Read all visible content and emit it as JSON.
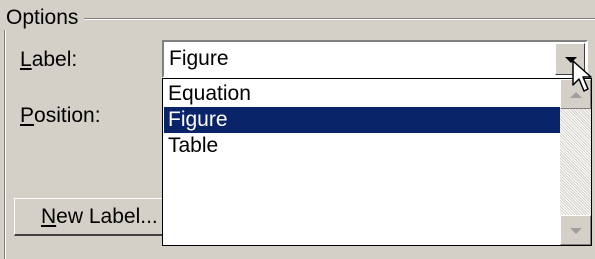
{
  "group": {
    "legend": "Options"
  },
  "label_field": {
    "label_prefix": "L",
    "label_rest": "abel:",
    "value": "Figure"
  },
  "position_field": {
    "label_prefix": "P",
    "label_rest": "osition:"
  },
  "dropdown": {
    "options": [
      "Equation",
      "Figure",
      "Table"
    ],
    "selected": "Figure"
  },
  "new_label_button": {
    "label_prefix": "N",
    "label_rest": "ew Label..."
  },
  "colors": {
    "selection_bg": "#0a246a",
    "dialog_bg": "#d4d0c8"
  }
}
